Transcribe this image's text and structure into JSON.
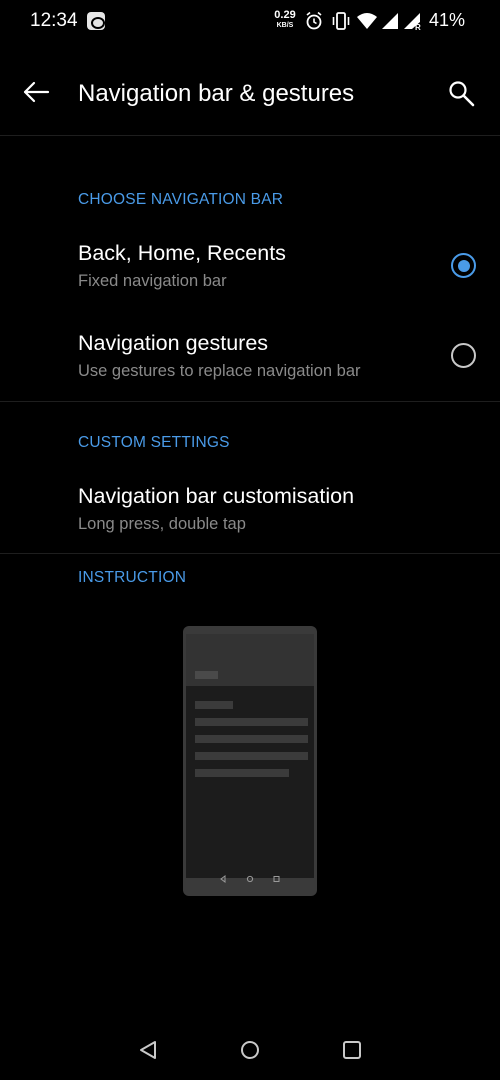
{
  "status_bar": {
    "time": "12:34",
    "net_speed_value": "0.29",
    "net_speed_unit": "KB/S",
    "battery": "41%",
    "icons": [
      "app-notification-icon",
      "alarm-icon",
      "vibrate-icon",
      "wifi-icon",
      "signal-icon",
      "signal-roaming-icon"
    ]
  },
  "header": {
    "title": "Navigation bar & gestures",
    "back_icon": "arrow-left-icon",
    "search_icon": "search-icon"
  },
  "sections": {
    "choose_nav": {
      "label": "CHOOSE NAVIGATION BAR",
      "options": [
        {
          "title": "Back, Home, Recents",
          "subtitle": "Fixed navigation bar",
          "selected": true
        },
        {
          "title": "Navigation gestures",
          "subtitle": "Use gestures to replace navigation bar",
          "selected": false
        }
      ]
    },
    "custom": {
      "label": "CUSTOM SETTINGS",
      "item": {
        "title": "Navigation bar customisation",
        "subtitle": "Long press, double tap"
      }
    },
    "instruction": {
      "label": "INSTRUCTION"
    }
  },
  "bottom_nav": [
    "back-triangle-icon",
    "home-circle-icon",
    "recents-square-icon"
  ],
  "colors": {
    "accent": "#4a9be8",
    "background": "#000000",
    "subtitle": "#8a8a8a"
  }
}
